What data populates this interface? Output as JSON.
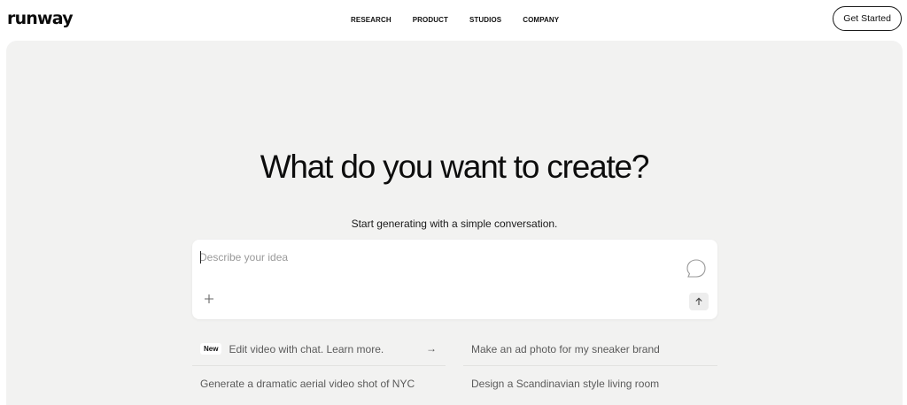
{
  "brand": {
    "logo": "runway"
  },
  "nav": {
    "items": [
      {
        "label": "RESEARCH"
      },
      {
        "label": "PRODUCT"
      },
      {
        "label": "STUDIOS"
      },
      {
        "label": "COMPANY"
      }
    ],
    "cta_label": "Get Started"
  },
  "hero": {
    "headline": "What do you want to create?",
    "subline": "Start generating with a simple conversation."
  },
  "prompt": {
    "placeholder": "Describe your idea",
    "value": "",
    "add_icon": "plus-icon",
    "send_icon": "arrow-up-icon",
    "assist_icon": "chat-bubble-icon"
  },
  "suggestions": [
    {
      "badge": "New",
      "text": "Edit video with chat. Learn more.",
      "icon": "arrow-right-icon"
    },
    {
      "text": "Make an ad photo for my sneaker brand"
    },
    {
      "text": "Generate a dramatic aerial video shot of NYC"
    },
    {
      "text": "Design a Scandinavian style living room"
    }
  ],
  "colors": {
    "hero_background": "#f2f2f1",
    "text_primary": "#0d0d0d",
    "text_muted": "#5b5b5b"
  }
}
